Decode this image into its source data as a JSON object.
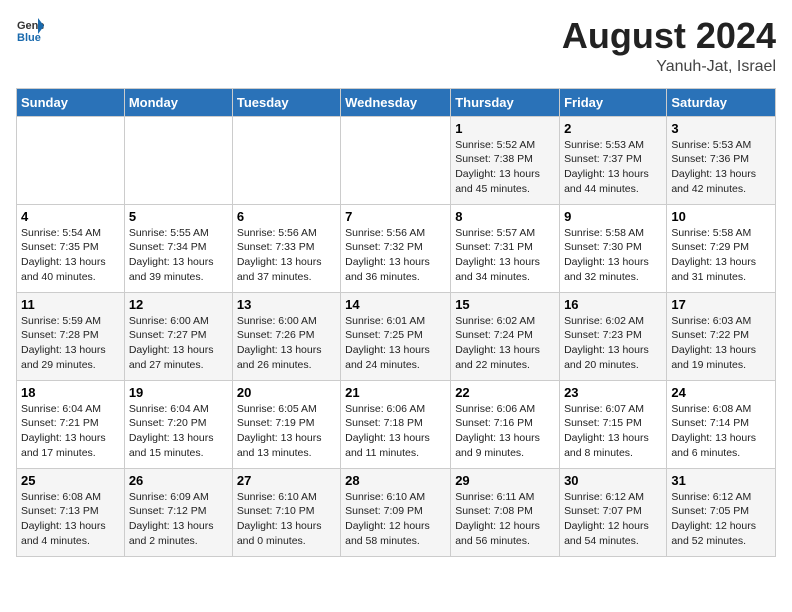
{
  "header": {
    "logo_general": "General",
    "logo_blue": "Blue",
    "title": "August 2024",
    "location": "Yanuh-Jat, Israel"
  },
  "days_of_week": [
    "Sunday",
    "Monday",
    "Tuesday",
    "Wednesday",
    "Thursday",
    "Friday",
    "Saturday"
  ],
  "weeks": [
    [
      {
        "day": "",
        "content": ""
      },
      {
        "day": "",
        "content": ""
      },
      {
        "day": "",
        "content": ""
      },
      {
        "day": "",
        "content": ""
      },
      {
        "day": "1",
        "content": "Sunrise: 5:52 AM\nSunset: 7:38 PM\nDaylight: 13 hours\nand 45 minutes."
      },
      {
        "day": "2",
        "content": "Sunrise: 5:53 AM\nSunset: 7:37 PM\nDaylight: 13 hours\nand 44 minutes."
      },
      {
        "day": "3",
        "content": "Sunrise: 5:53 AM\nSunset: 7:36 PM\nDaylight: 13 hours\nand 42 minutes."
      }
    ],
    [
      {
        "day": "4",
        "content": "Sunrise: 5:54 AM\nSunset: 7:35 PM\nDaylight: 13 hours\nand 40 minutes."
      },
      {
        "day": "5",
        "content": "Sunrise: 5:55 AM\nSunset: 7:34 PM\nDaylight: 13 hours\nand 39 minutes."
      },
      {
        "day": "6",
        "content": "Sunrise: 5:56 AM\nSunset: 7:33 PM\nDaylight: 13 hours\nand 37 minutes."
      },
      {
        "day": "7",
        "content": "Sunrise: 5:56 AM\nSunset: 7:32 PM\nDaylight: 13 hours\nand 36 minutes."
      },
      {
        "day": "8",
        "content": "Sunrise: 5:57 AM\nSunset: 7:31 PM\nDaylight: 13 hours\nand 34 minutes."
      },
      {
        "day": "9",
        "content": "Sunrise: 5:58 AM\nSunset: 7:30 PM\nDaylight: 13 hours\nand 32 minutes."
      },
      {
        "day": "10",
        "content": "Sunrise: 5:58 AM\nSunset: 7:29 PM\nDaylight: 13 hours\nand 31 minutes."
      }
    ],
    [
      {
        "day": "11",
        "content": "Sunrise: 5:59 AM\nSunset: 7:28 PM\nDaylight: 13 hours\nand 29 minutes."
      },
      {
        "day": "12",
        "content": "Sunrise: 6:00 AM\nSunset: 7:27 PM\nDaylight: 13 hours\nand 27 minutes."
      },
      {
        "day": "13",
        "content": "Sunrise: 6:00 AM\nSunset: 7:26 PM\nDaylight: 13 hours\nand 26 minutes."
      },
      {
        "day": "14",
        "content": "Sunrise: 6:01 AM\nSunset: 7:25 PM\nDaylight: 13 hours\nand 24 minutes."
      },
      {
        "day": "15",
        "content": "Sunrise: 6:02 AM\nSunset: 7:24 PM\nDaylight: 13 hours\nand 22 minutes."
      },
      {
        "day": "16",
        "content": "Sunrise: 6:02 AM\nSunset: 7:23 PM\nDaylight: 13 hours\nand 20 minutes."
      },
      {
        "day": "17",
        "content": "Sunrise: 6:03 AM\nSunset: 7:22 PM\nDaylight: 13 hours\nand 19 minutes."
      }
    ],
    [
      {
        "day": "18",
        "content": "Sunrise: 6:04 AM\nSunset: 7:21 PM\nDaylight: 13 hours\nand 17 minutes."
      },
      {
        "day": "19",
        "content": "Sunrise: 6:04 AM\nSunset: 7:20 PM\nDaylight: 13 hours\nand 15 minutes."
      },
      {
        "day": "20",
        "content": "Sunrise: 6:05 AM\nSunset: 7:19 PM\nDaylight: 13 hours\nand 13 minutes."
      },
      {
        "day": "21",
        "content": "Sunrise: 6:06 AM\nSunset: 7:18 PM\nDaylight: 13 hours\nand 11 minutes."
      },
      {
        "day": "22",
        "content": "Sunrise: 6:06 AM\nSunset: 7:16 PM\nDaylight: 13 hours\nand 9 minutes."
      },
      {
        "day": "23",
        "content": "Sunrise: 6:07 AM\nSunset: 7:15 PM\nDaylight: 13 hours\nand 8 minutes."
      },
      {
        "day": "24",
        "content": "Sunrise: 6:08 AM\nSunset: 7:14 PM\nDaylight: 13 hours\nand 6 minutes."
      }
    ],
    [
      {
        "day": "25",
        "content": "Sunrise: 6:08 AM\nSunset: 7:13 PM\nDaylight: 13 hours\nand 4 minutes."
      },
      {
        "day": "26",
        "content": "Sunrise: 6:09 AM\nSunset: 7:12 PM\nDaylight: 13 hours\nand 2 minutes."
      },
      {
        "day": "27",
        "content": "Sunrise: 6:10 AM\nSunset: 7:10 PM\nDaylight: 13 hours\nand 0 minutes."
      },
      {
        "day": "28",
        "content": "Sunrise: 6:10 AM\nSunset: 7:09 PM\nDaylight: 12 hours\nand 58 minutes."
      },
      {
        "day": "29",
        "content": "Sunrise: 6:11 AM\nSunset: 7:08 PM\nDaylight: 12 hours\nand 56 minutes."
      },
      {
        "day": "30",
        "content": "Sunrise: 6:12 AM\nSunset: 7:07 PM\nDaylight: 12 hours\nand 54 minutes."
      },
      {
        "day": "31",
        "content": "Sunrise: 6:12 AM\nSunset: 7:05 PM\nDaylight: 12 hours\nand 52 minutes."
      }
    ]
  ]
}
